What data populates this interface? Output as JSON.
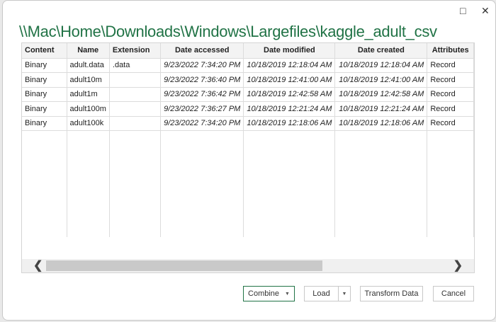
{
  "window": {
    "maximize_icon": "□",
    "close_icon": "✕"
  },
  "title": "\\\\Mac\\Home\\Downloads\\Windows\\Largefiles\\kaggle_adult_csv",
  "table": {
    "headers": [
      "Content",
      "Name",
      "Extension",
      "Date accessed",
      "Date modified",
      "Date created",
      "Attributes"
    ],
    "rows": [
      [
        "Binary",
        "adult.data",
        ".data",
        "9/23/2022 7:34:20 PM",
        "10/18/2019 12:18:04 AM",
        "10/18/2019 12:18:04 AM",
        "Record"
      ],
      [
        "Binary",
        "adult10m",
        "",
        "9/23/2022 7:36:40 PM",
        "10/18/2019 12:41:00 AM",
        "10/18/2019 12:41:00 AM",
        "Record"
      ],
      [
        "Binary",
        "adult1m",
        "",
        "9/23/2022 7:36:42 PM",
        "10/18/2019 12:42:58 AM",
        "10/18/2019 12:42:58 AM",
        "Record"
      ],
      [
        "Binary",
        "adult100m",
        "",
        "9/23/2022 7:36:27 PM",
        "10/18/2019 12:21:24 AM",
        "10/18/2019 12:21:24 AM",
        "Record"
      ],
      [
        "Binary",
        "adult100k",
        "",
        "9/23/2022 7:34:20 PM",
        "10/18/2019 12:18:06 AM",
        "10/18/2019 12:18:06 AM",
        "Record"
      ]
    ]
  },
  "scroll": {
    "left": "❮",
    "right": "❯"
  },
  "buttons": {
    "combine": "Combine",
    "load": "Load",
    "transform": "Transform Data",
    "cancel": "Cancel",
    "caret": "▼"
  }
}
